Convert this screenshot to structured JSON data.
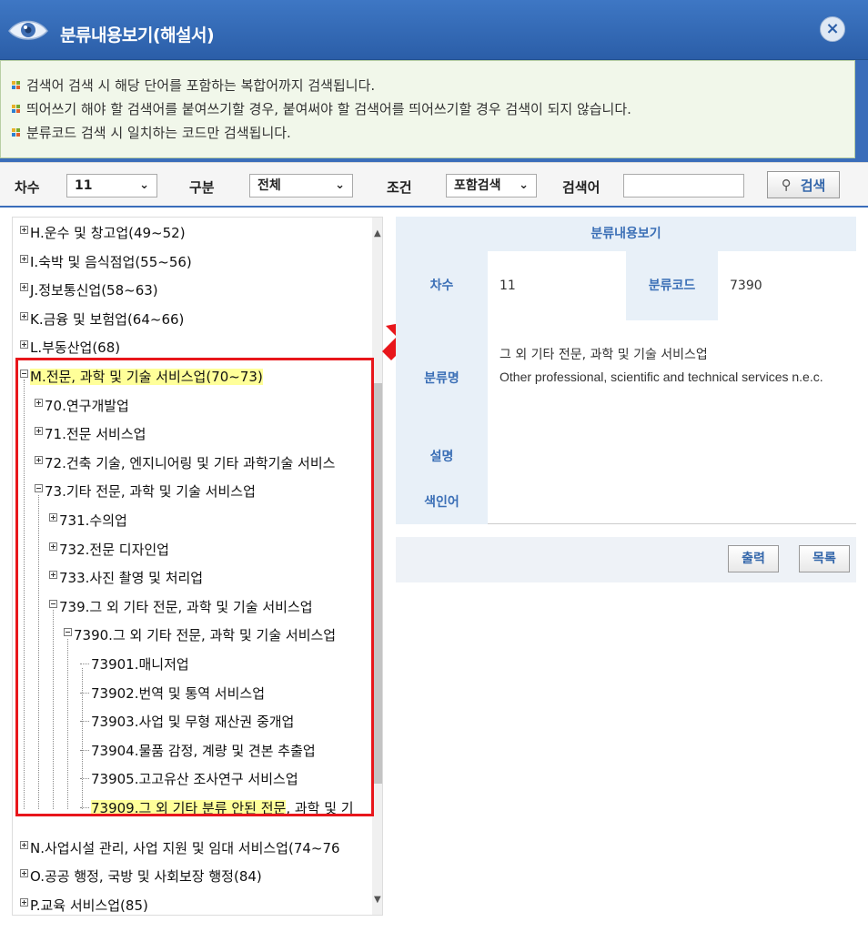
{
  "window": {
    "title": "분류내용보기(해설서)",
    "close_label": "×"
  },
  "notice": {
    "lines": [
      "검색어 검색 시 해당 단어를 포함하는 복합어까지 검색됩니다.",
      "띄어쓰기 해야 할 검색어를 붙여쓰기할 경우, 붙여써야 할 검색어를 띄어쓰기할 경우 검색이 되지 않습니다.",
      "분류코드 검색 시 일치하는 코드만 검색됩니다."
    ]
  },
  "search": {
    "revision_label": "차수",
    "revision_value": "11",
    "type_label": "구분",
    "type_value": "전체",
    "condition_label": "조건",
    "condition_value": "포함검색",
    "keyword_label": "검색어",
    "keyword_value": "",
    "button_label": "검색"
  },
  "tree": {
    "items": [
      {
        "label": "H.운수 및 창고업(49~52)",
        "state": "collapsed",
        "level": 0
      },
      {
        "label": "I.숙박 및 음식점업(55~56)",
        "state": "collapsed",
        "level": 0
      },
      {
        "label": "J.정보통신업(58~63)",
        "state": "collapsed",
        "level": 0
      },
      {
        "label": "K.금융 및 보험업(64~66)",
        "state": "collapsed",
        "level": 0
      },
      {
        "label": "L.부동산업(68)",
        "state": "collapsed",
        "level": 0
      },
      {
        "label": "M.전문, 과학 및 기술 서비스업(70~73)",
        "state": "expanded",
        "level": 0,
        "highlight": "full"
      },
      {
        "label": "70.연구개발업",
        "state": "collapsed",
        "level": 1
      },
      {
        "label": "71.전문 서비스업",
        "state": "collapsed",
        "level": 1
      },
      {
        "label": "72.건축 기술, 엔지니어링 및 기타 과학기술 서비스",
        "state": "collapsed",
        "level": 1
      },
      {
        "label": "73.기타 전문, 과학 및 기술 서비스업",
        "state": "expanded",
        "level": 1
      },
      {
        "label": "731.수의업",
        "state": "collapsed",
        "level": 2
      },
      {
        "label": "732.전문 디자인업",
        "state": "collapsed",
        "level": 2
      },
      {
        "label": "733.사진 촬영 및 처리업",
        "state": "collapsed",
        "level": 2
      },
      {
        "label": "739.그 외 기타 전문, 과학 및 기술 서비스업",
        "state": "expanded",
        "level": 2
      },
      {
        "label": "7390.그 외 기타 전문, 과학 및 기술 서비스업",
        "state": "expanded",
        "level": 3
      },
      {
        "label": "73901.매니저업",
        "state": "leaf",
        "level": 4
      },
      {
        "label": "73902.번역 및 통역 서비스업",
        "state": "leaf",
        "level": 4
      },
      {
        "label": "73903.사업 및 무형 재산권 중개업",
        "state": "leaf",
        "level": 4
      },
      {
        "label": "73904.물품 감정, 계량 및 견본 추출업",
        "state": "leaf",
        "level": 4
      },
      {
        "label": "73905.고고유산 조사연구 서비스업",
        "state": "leaf",
        "level": 4
      },
      {
        "label": "73909.그 외 기타 분류 안된 전문",
        "label_rest": ", 과학 및 기",
        "state": "leaf",
        "level": 4,
        "highlight": "partial"
      },
      {
        "label": "N.사업시설 관리, 사업 지원 및 임대 서비스업(74~76",
        "state": "collapsed",
        "level": 0
      },
      {
        "label": "O.공공 행정, 국방 및 사회보장 행정(84)",
        "state": "collapsed",
        "level": 0
      },
      {
        "label": "P.교육 서비스업(85)",
        "state": "collapsed",
        "level": 0
      }
    ]
  },
  "detail": {
    "header": "분류내용보기",
    "revision_label": "차수",
    "revision_value": "11",
    "code_label": "분류코드",
    "code_value": "7390",
    "name_label": "분류명",
    "name_ko": "그 외 기타 전문, 과학 및 기술 서비스업",
    "name_en": "Other professional, scientific and technical services n.e.c.",
    "desc_label": "설명",
    "desc_value": "",
    "index_label": "색인어",
    "index_value": "",
    "print_label": "출력",
    "list_label": "목록"
  },
  "colors": {
    "title_bar": "#3e77c4",
    "highlight": "#ffff99",
    "annotation_red": "#e8161b",
    "header_text": "#3b6fb6"
  },
  "icons": {
    "title": "eye-icon",
    "close": "close-icon",
    "search": "search-icon",
    "bullet": "four-square-bullet-icon",
    "annotation": "red-arrow-icon"
  }
}
